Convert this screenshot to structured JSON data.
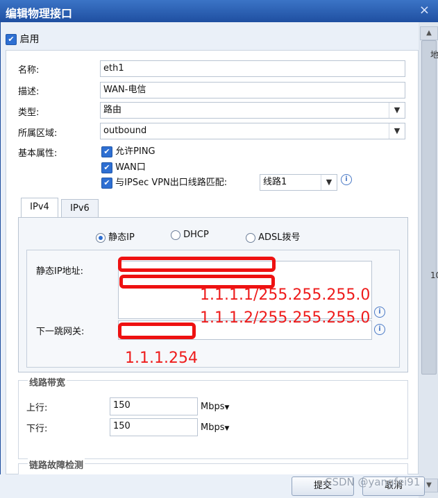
{
  "dialog": {
    "title": "编辑物理接口",
    "close_icon": "×"
  },
  "enable": {
    "label": "启用",
    "checked": true
  },
  "form": {
    "name_label": "名称:",
    "name_value": "eth1",
    "desc_label": "描述:",
    "desc_value": "WAN-电信",
    "type_label": "类型:",
    "type_value": "路由",
    "zone_label": "所属区域:",
    "zone_value": "outbound",
    "attr_label": "基本属性:",
    "allow_ping": "允许PING",
    "wan_port": "WAN口",
    "ipsec_match": "与IPSec VPN出口线路匹配:",
    "line_select": "线路1"
  },
  "tabs": [
    {
      "label": "IPv4"
    },
    {
      "label": "IPv6"
    }
  ],
  "ip_mode": {
    "static": "静态IP",
    "dhcp": "DHCP",
    "adsl": "ADSL拨号",
    "selected": "static"
  },
  "static_ip": {
    "address_label": "静态IP地址:",
    "gateway_label": "下一跳网关:",
    "annotation_ip1": "1.1.1.1/255.255.255.0",
    "annotation_ip2": "1.1.1.2/255.255.255.0",
    "annotation_gw": "1.1.1.254"
  },
  "bandwidth": {
    "title": "线路带宽",
    "up_label": "上行:",
    "up_value": "150",
    "up_unit": "Mbps",
    "down_label": "下行:",
    "down_value": "150",
    "down_unit": "Mbps"
  },
  "fault_detect": {
    "title": "链路故障检测"
  },
  "buttons": {
    "submit": "提交",
    "cancel": "取消"
  },
  "watermark": "CSDN @yangfei91",
  "edge_labels": {
    "top": "地",
    "mid": "10"
  },
  "colors": {
    "title_bar": "#2b5fb4",
    "accent_red": "#ee1111",
    "checkbox": "#2e6fd2"
  }
}
